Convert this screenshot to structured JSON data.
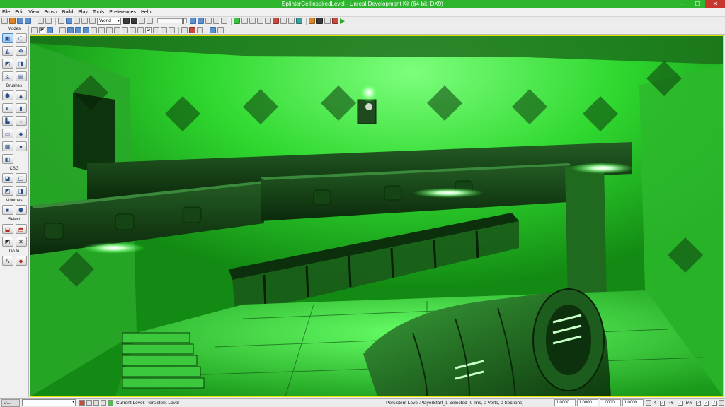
{
  "window": {
    "title": "SplinterCellInspiredLevel - Unreal Development Kit (64-bit, DX9)",
    "minimize": "—",
    "maximize": "☐",
    "close": "✕"
  },
  "menu": [
    "File",
    "Edit",
    "View",
    "Brush",
    "Build",
    "Play",
    "Tools",
    "Preferences",
    "Help"
  ],
  "toolbar": {
    "coordinate_system": "World"
  },
  "modes_panel": {
    "modes_label": "Modes",
    "brushes_label": "Brushes",
    "csg_label": "CSG",
    "volumes_label": "Volumes",
    "select_label": "Select",
    "goto_label": "Go to"
  },
  "viewport_toolbar": {
    "perspective_letter": "P",
    "game_letter": "G"
  },
  "status": {
    "task_button": "U...",
    "current_level": "Current Level:  Persistent Level",
    "selection": "Persistent Level.PlayerStart_1 Selected (0 Tris, 0 Verts, 0 Sections)",
    "drag_grid_values": [
      "1.0000",
      "1.0000",
      "1.0000",
      "1.0000"
    ],
    "grid_size": "4",
    "rotation_snap": "~6",
    "scale_snap": "5%"
  },
  "colors": {
    "titlebar": "#2db52d",
    "viewport_tint": "#2fd82f",
    "viewport_border": "#e1e100"
  }
}
